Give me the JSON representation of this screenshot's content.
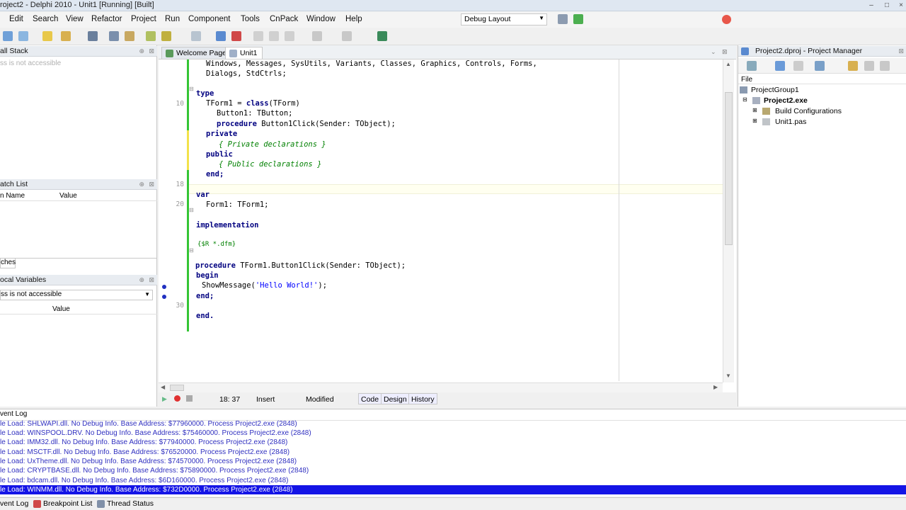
{
  "window": {
    "title": "roject2 - Delphi 2010 - Unit1 [Running] [Built]",
    "controls": [
      "–",
      "□",
      "×"
    ]
  },
  "menu": [
    "Edit",
    "Search",
    "View",
    "Refactor",
    "Project",
    "Run",
    "Component",
    "Tools",
    "CnPack",
    "Window",
    "Help"
  ],
  "toolbar": {
    "layout_select": "Debug Layout",
    "icons": [
      "new-icon",
      "open-icon",
      "save-icon",
      "save-all-icon",
      "open-project-icon",
      "run-icon",
      "pause-icon",
      "stop-icon",
      "step-over-icon",
      "trace-into-icon",
      "back-icon",
      "forward-icon",
      "component-icon"
    ]
  },
  "left": {
    "call_stack": {
      "title": "all Stack",
      "message": "ss is not accessible"
    },
    "watch_list": {
      "title": "atch List",
      "columns": [
        "n Name",
        "Value"
      ],
      "tab": "ches"
    },
    "local_variables": {
      "title": "ocal Variables",
      "selector": "ss is not accessible",
      "column": "Value"
    }
  },
  "editor": {
    "tabs": [
      "Welcome Page",
      "Unit1"
    ],
    "line_numbers": [
      "10",
      "18",
      "20",
      "30"
    ],
    "code": {
      "l1": "Windows, Messages, SysUtils, Variants, Classes, Graphics, Controls, Forms,",
      "l2": "Dialogs, StdCtrls;",
      "l3": "type",
      "l4a": "TForm1 = ",
      "l4b": "class",
      "l4c": "(TForm)",
      "l5": "Button1: TButton;",
      "l6a": "procedure",
      "l6b": " Button1Click(Sender: TObject);",
      "l7": "private",
      "l8": "{ Private declarations }",
      "l9": "public",
      "l10": "{ Public declarations }",
      "l11": "end;",
      "l12": "var",
      "l13": "Form1: TForm1;",
      "l14": "implementation",
      "l15": "{$R *.dfm}",
      "l16a": "procedure",
      "l16b": " TForm1.Button1Click(Sender: TObject);",
      "l17": "begin",
      "l18a": "ShowMessage(",
      "l18b": "'Hello World!'",
      "l18c": ");",
      "l19": "end;",
      "l20": "end."
    },
    "status": {
      "position": "18: 37",
      "mode": "Insert",
      "state": "Modified",
      "views": [
        "Code",
        "Design",
        "History"
      ]
    }
  },
  "project_manager": {
    "title": "Project2.dproj - Project Manager",
    "header": "File",
    "tree": [
      "ProjectGroup1",
      "Project2.exe",
      "Build Configurations",
      "Unit1.pas"
    ]
  },
  "event_log": {
    "title": "vent Log",
    "lines": [
      "le Load: SHLWAPI.dll. No Debug Info. Base Address: $77960000. Process Project2.exe (2848)",
      "le Load: WINSPOOL.DRV. No Debug Info. Base Address: $75460000. Process Project2.exe (2848)",
      "le Load: IMM32.dll. No Debug Info. Base Address: $77940000. Process Project2.exe (2848)",
      "le Load: MSCTF.dll. No Debug Info. Base Address: $76520000. Process Project2.exe (2848)",
      "le Load: UxTheme.dll. No Debug Info. Base Address: $74570000. Process Project2.exe (2848)",
      "le Load: CRYPTBASE.dll. No Debug Info. Base Address: $75890000. Process Project2.exe (2848)",
      "le Load: bdcam.dll. No Debug Info. Base Address: $6D160000. Process Project2.exe (2848)",
      "le Load: WINMM.dll. No Debug Info. Base Address: $732D0000. Process Project2.exe (2848)"
    ]
  },
  "bottom_tabs": [
    "vent Log",
    "Breakpoint List",
    "Thread Status"
  ],
  "colors": {
    "change_bar": "#34c534",
    "selection": "#1414e6",
    "keyword": "#000080",
    "comment": "#008000",
    "string": "#0000ff"
  }
}
